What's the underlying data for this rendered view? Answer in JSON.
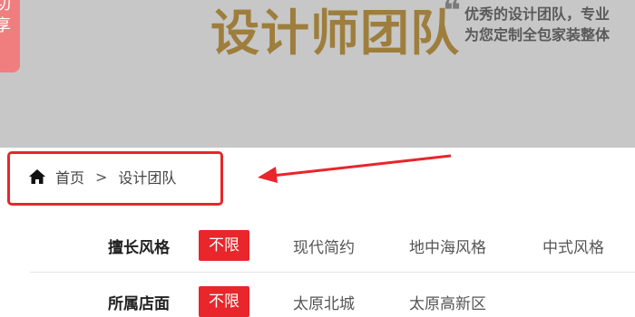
{
  "banner": {
    "share_glyph_1": "功",
    "share_glyph_2": "享",
    "title": "设计师团队",
    "quote_mark": "❝",
    "slogan_line1": "优秀的设计团队，专业",
    "slogan_line2": "为您定制全包家装整体"
  },
  "breadcrumb": {
    "icon": "home-icon",
    "home": "首页",
    "separator": ">",
    "current": "设计团队"
  },
  "filters": {
    "style": {
      "label": "擅长风格",
      "options": [
        "不限",
        "现代简约",
        "地中海风格",
        "中式风格"
      ]
    },
    "store": {
      "label": "所属店面",
      "options": [
        "不限",
        "太原北城",
        "太原高新区"
      ]
    }
  },
  "colors": {
    "accent": "#e8262b",
    "banner_bg": "#c7c7c7",
    "title_gold": "#9e7e3d"
  }
}
